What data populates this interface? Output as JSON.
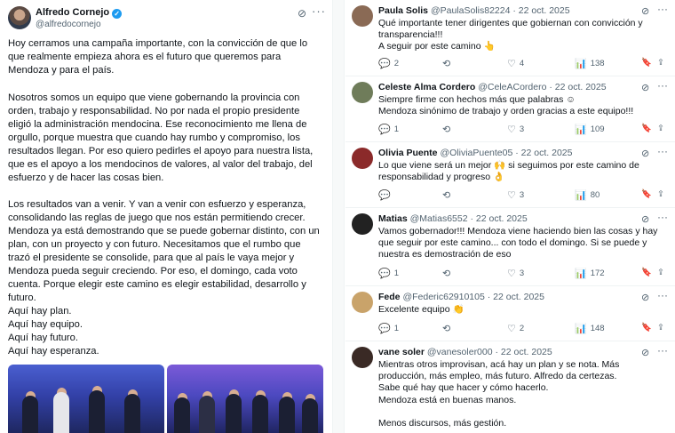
{
  "main_post": {
    "author_name": "Alfredo Cornejo",
    "verified_icon": "✓",
    "handle": "@alfredocornejo",
    "grok_icon": "⊘",
    "more_icon": "···",
    "paragraphs": [
      "Hoy cerramos una campaña importante, con la convicción de que lo que realmente empieza ahora es el futuro que queremos para Mendoza y para el país.",
      "Nosotros somos un equipo que viene gobernando la provincia con orden, trabajo y responsabilidad. No por nada el propio presidente eligió la administración mendocina. Ese reconocimiento me llena de orgullo, porque muestra que cuando hay rumbo y compromiso, los resultados llegan. Por eso quiero pedirles el apoyo para nuestra lista, que es el apoyo a los mendocinos de valores, al valor del trabajo, del esfuerzo y de hacer las cosas bien.",
      "Los resultados van a venir. Y van a venir con esfuerzo y esperanza, consolidando las reglas de juego que nos están permitiendo crecer. Mendoza ya está demostrando que se puede gobernar distinto, con un plan, con un proyecto y con futuro. Necesitamos que el rumbo que trazó el presidente se consolide, para que al país le vaya mejor y Mendoza pueda seguir creciendo. Por eso, el domingo, cada voto cuenta. Porque elegir este camino es elegir estabilidad, desarrollo y futuro."
    ],
    "closing_lines": [
      "Aquí hay plan.",
      "Aquí hay equipo.",
      "Aquí hay futuro.",
      "Aquí hay esperanza."
    ]
  },
  "replies": [
    {
      "name": "Paula Solis",
      "handle": "@PaulaSolis82224",
      "date": "· 22 oct. 2025",
      "lines": [
        "Qué importante tener dirigentes que gobiernan con convicción y transparencia!!!",
        "A seguir por este camino 👆"
      ],
      "reply_count": "2",
      "retweet_count": "",
      "like_count": "4",
      "view_count": "138",
      "avatar_color": "#8a6a55"
    },
    {
      "name": "Celeste Alma Cordero",
      "handle": "@CeleACordero",
      "date": "· 22 oct. 2025",
      "lines": [
        "Siempre firme con hechos más que palabras ☺",
        " Mendoza sinónimo de trabajo y orden gracias a este equipo!!!"
      ],
      "reply_count": "1",
      "retweet_count": "",
      "like_count": "3",
      "view_count": "109",
      "avatar_color": "#6f7c5a"
    },
    {
      "name": "Olivia Puente",
      "handle": "@OliviaPuente05",
      "date": "· 22 oct. 2025",
      "lines": [
        "Lo que viene será un mejor 🙌 si seguimos por este camino de responsabilidad y progreso 👌"
      ],
      "reply_count": "",
      "retweet_count": "",
      "like_count": "3",
      "view_count": "80",
      "avatar_color": "#8b2a2a"
    },
    {
      "name": "Matias",
      "handle": "@Matias6552",
      "date": "· 22 oct. 2025",
      "lines": [
        "Vamos gobernador!!! Mendoza viene haciendo bien las cosas y hay que seguir por este camino... con todo el domingo. Si se puede y nuestra es demostración de eso"
      ],
      "reply_count": "1",
      "retweet_count": "",
      "like_count": "3",
      "view_count": "172",
      "avatar_color": "#222222"
    },
    {
      "name": "Fede",
      "handle": "@Federic62910105",
      "date": "· 22 oct. 2025",
      "lines": [
        "Excelente equipo 👏"
      ],
      "reply_count": "1",
      "retweet_count": "",
      "like_count": "2",
      "view_count": "148",
      "avatar_color": "#c9a36a"
    },
    {
      "name": "vane soler",
      "handle": "@vanesoler000",
      "date": "· 22 oct. 2025",
      "lines": [
        "Mientras otros improvisan, acá hay un plan y se nota. Más producción, más empleo, más futuro. Alfredo da certezas.",
        "Sabe qué hay que hacer y cómo hacerlo.",
        "Mendoza está en buenas manos.",
        "",
        "Menos discursos, más gestión."
      ],
      "reply_count": "",
      "retweet_count": "",
      "like_count": "",
      "view_count": "",
      "avatar_color": "#3a2a25"
    }
  ],
  "icons": {
    "reply": "💬",
    "retweet": "⟲",
    "like": "♡",
    "views": "📊",
    "bookmark": "🔖",
    "share": "⇪",
    "grok": "⊘",
    "more": "···"
  }
}
